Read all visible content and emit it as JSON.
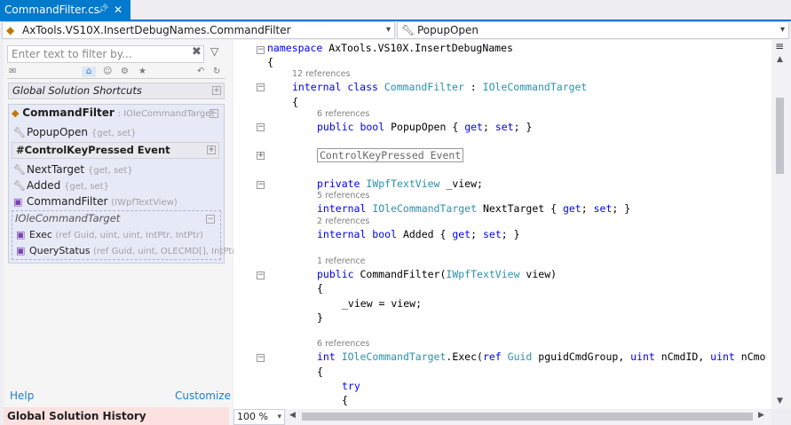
{
  "tab": {
    "title": "CommandFilter.cs",
    "pin_icon": "pin-icon",
    "close_icon": "close-icon"
  },
  "nav": {
    "left_combo": "AxTools.VS10X.InsertDebugNames.CommandFilter",
    "right_combo": "PopupOpen"
  },
  "left_panel": {
    "filter_placeholder": "Enter text to filter by...",
    "global_shortcuts": "Global Solution Shortcuts",
    "class_name": "CommandFilter",
    "class_hint": ": IOleCommandTarget",
    "members_top": [
      {
        "name": "PopupOpen",
        "hint": "{get, set}"
      }
    ],
    "event_group": "#ControlKeyPressed Event",
    "members": [
      {
        "name": "NextTarget",
        "hint": "{get, set}"
      },
      {
        "name": "Added",
        "hint": "{get, set}"
      },
      {
        "name": "CommandFilter",
        "hint": "(IWpfTextView)"
      }
    ],
    "iface_group": "IOleCommandTarget",
    "iface_members": [
      {
        "name": "Exec",
        "hint": "(ref Guid, uint, uint, IntPtr, IntPtr)"
      },
      {
        "name": "QueryStatus",
        "hint": "(ref Guid, uint, OLECMD[], IntPtr)"
      }
    ],
    "help": "Help",
    "customize": "Customize",
    "history": "Global Solution History"
  },
  "editor": {
    "zoom": "100 %",
    "refs": {
      "r12": "12 references",
      "r6a": "6 references",
      "r5": "5 references",
      "r2": "2 references",
      "r1": "1 reference",
      "r6b": "6 references"
    },
    "lines": {
      "l1a": "namespace",
      "l1b": " AxTools.VS10X.InsertDebugNames",
      "l2": "{",
      "l3a": "internal class ",
      "l3b": "CommandFilter",
      "l3c": " : ",
      "l3d": "IOleCommandTarget",
      "l4": "{",
      "l5a": "public bool",
      "l5b": " PopupOpen { ",
      "l5c": "get",
      "l5d": "; ",
      "l5e": "set",
      "l5f": "; }",
      "l6": "ControlKeyPressed Event",
      "l7a": "private ",
      "l7b": "IWpfTextView",
      "l7c": " _view;",
      "l8a": "internal ",
      "l8b": "IOleCommandTarget",
      "l8c": " NextTarget { ",
      "l8d": "get",
      "l8e": "; ",
      "l8f": "set",
      "l8g": "; }",
      "l9a": "internal bool",
      "l9b": " Added { ",
      "l9c": "get",
      "l9d": "; ",
      "l9e": "set",
      "l9f": "; }",
      "l10a": "public",
      "l10b": " CommandFilter(",
      "l10c": "IWpfTextView",
      "l10d": " view)",
      "l11": "{",
      "l12": "_view = view;",
      "l13": "}",
      "l14a": "int ",
      "l14b": "IOleCommandTarget",
      "l14c": ".Exec(",
      "l14d": "ref ",
      "l14e": "Guid",
      "l14f": " pguidCmdGroup, ",
      "l14g": "uint",
      "l14h": " nCmdID, ",
      "l14i": "uint",
      "l14j": " nCmo",
      "l15": "{",
      "l16": "try",
      "l17": "{"
    }
  },
  "colors": {
    "accent": "#007acc",
    "keyword": "#0000ff",
    "type": "#2b91af",
    "lens": "#808080",
    "history_bg": "#fbe2e0",
    "link": "#1e7fd0"
  }
}
